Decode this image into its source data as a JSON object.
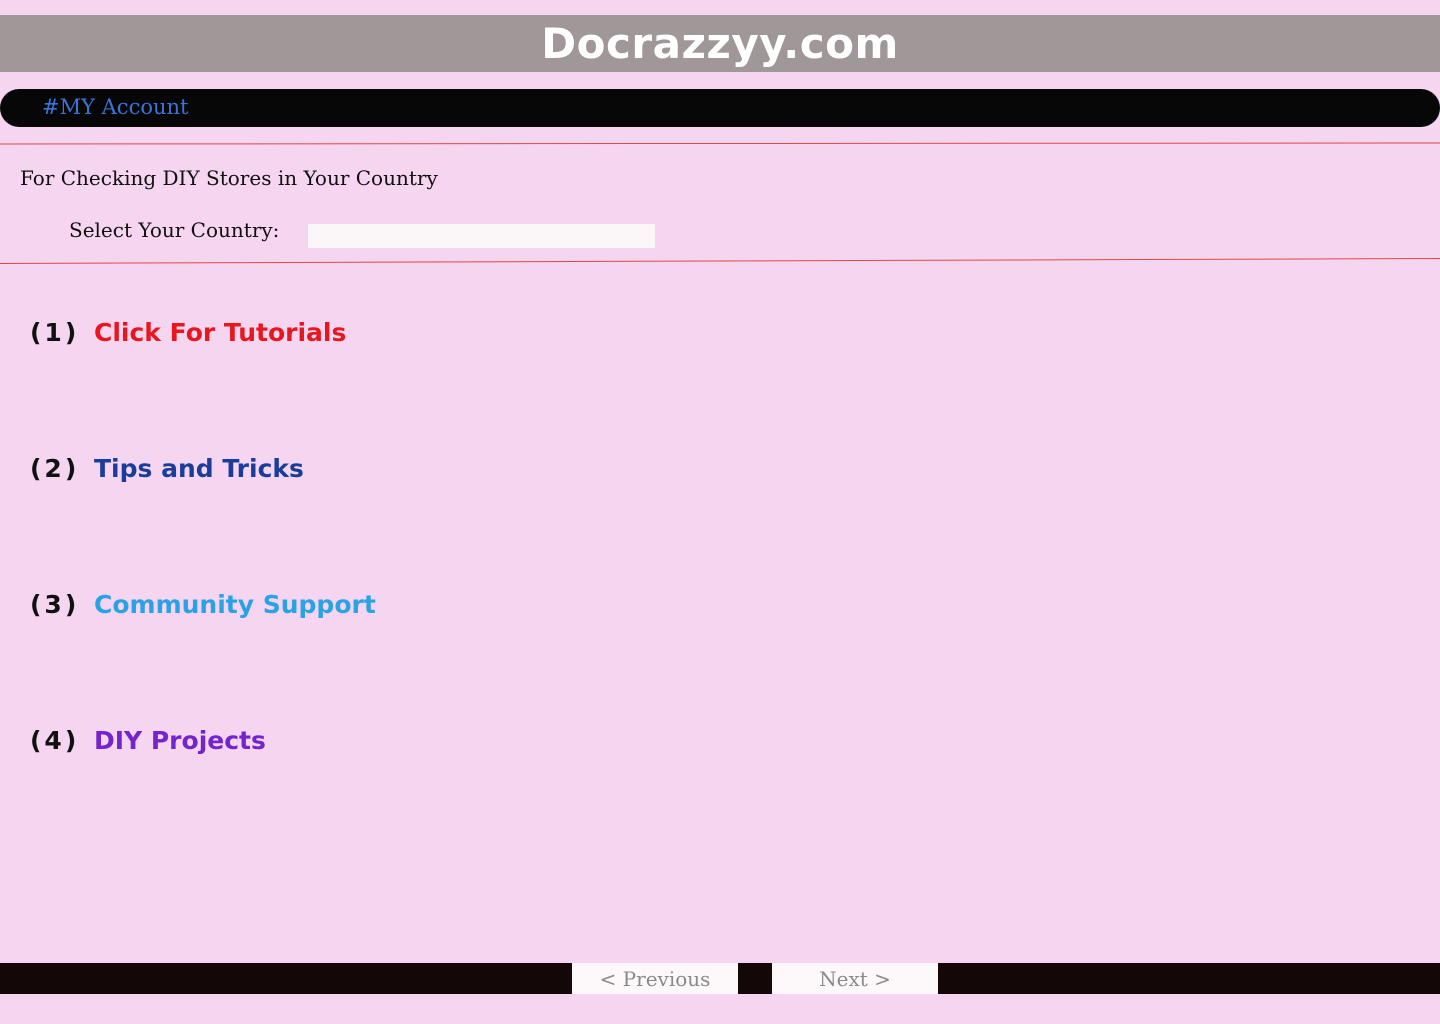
{
  "header": {
    "title": "Docrazzyy.com"
  },
  "account": {
    "label": "#MY Account"
  },
  "country": {
    "heading": "For Checking DIY Stores in Your Country",
    "select_label": "Select Your Country:",
    "value": ""
  },
  "menu": {
    "items": [
      {
        "number": "(1)",
        "label": "Click For Tutorials",
        "color": "#e8171f"
      },
      {
        "number": "(2)",
        "label": "Tips and Tricks",
        "color": "#1a3d9c"
      },
      {
        "number": "(3)",
        "label": "Community Support",
        "color": "#2aa3e6"
      },
      {
        "number": "(4)",
        "label": "DIY Projects",
        "color": "#7424cc"
      }
    ]
  },
  "pagination": {
    "previous": "< Previous",
    "next": "Next >"
  }
}
